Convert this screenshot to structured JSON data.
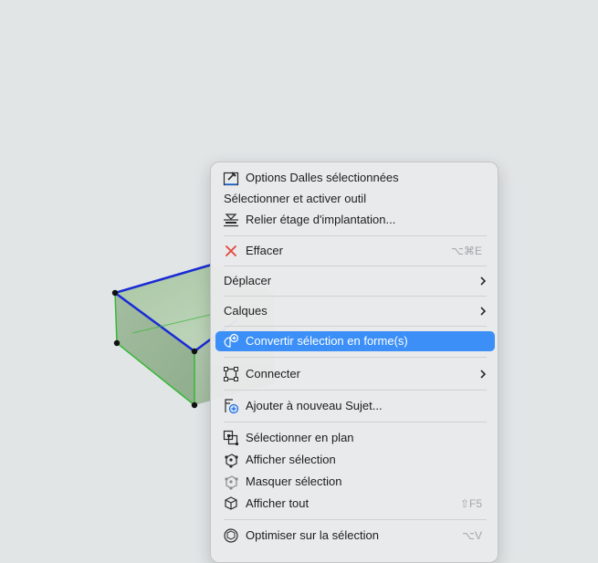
{
  "menu": {
    "items": [
      {
        "label": "Options Dalles sélectionnées",
        "icon": "slab-options-icon"
      },
      {
        "label": "Sélectionner et activer outil"
      },
      {
        "label": "Relier étage d'implantation...",
        "icon": "home-story-icon"
      },
      {
        "label": "Effacer",
        "icon": "delete-x-icon",
        "shortcut": "⌥⌘E"
      },
      {
        "label": "Déplacer",
        "submenu": true
      },
      {
        "label": "Calques",
        "submenu": true
      },
      {
        "label": "Convertir sélection en forme(s)",
        "icon": "convert-to-morph-icon",
        "highlighted": true
      },
      {
        "label": "Connecter",
        "icon": "connect-icon",
        "submenu": true
      },
      {
        "label": "Ajouter à nouveau Sujet...",
        "icon": "add-issue-icon"
      },
      {
        "label": "Sélectionner en plan",
        "icon": "select-in-plan-icon"
      },
      {
        "label": "Afficher sélection",
        "icon": "show-selection-icon"
      },
      {
        "label": "Masquer sélection",
        "icon": "hide-selection-icon"
      },
      {
        "label": "Afficher tout",
        "icon": "show-all-icon",
        "shortcut": "⇧F5"
      },
      {
        "label": "Optimiser sur la sélection",
        "icon": "optimize-selection-icon",
        "shortcut": "⌥V"
      }
    ]
  },
  "colors": {
    "highlight": "#3c8ff6",
    "delete_icon": "#e5463b",
    "selection_edge_blue": "#1a2bd6",
    "selection_edge_green": "#36b836"
  }
}
